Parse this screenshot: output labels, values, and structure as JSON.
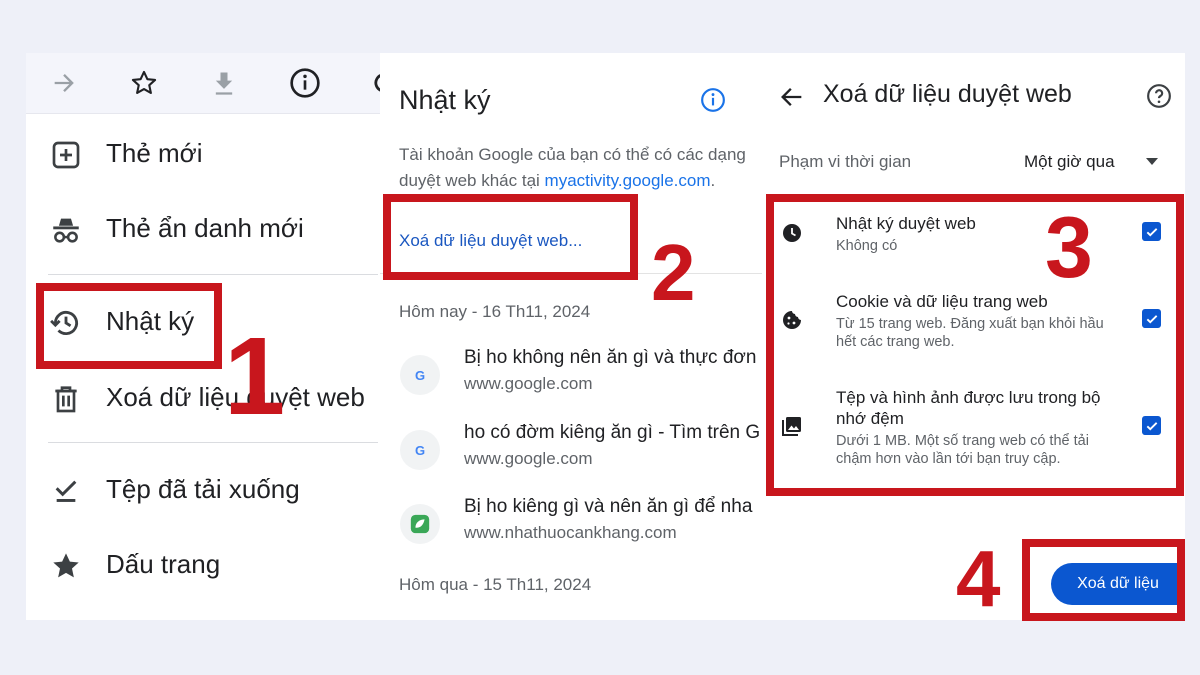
{
  "menu": {
    "toolbar_icons": [
      "arrow-forward-icon",
      "star-icon",
      "download-icon",
      "info-icon",
      "refresh-icon"
    ],
    "items": [
      {
        "label": "Thẻ mới",
        "icon": "new-tab-icon"
      },
      {
        "label": "Thẻ ẩn danh mới",
        "icon": "incognito-icon"
      },
      {
        "label": "Nhật ký",
        "icon": "history-icon"
      },
      {
        "label": "Xoá dữ liệu duyệt web",
        "icon": "trash-icon"
      },
      {
        "label": "Tệp đã tải xuống",
        "icon": "download-done-icon"
      },
      {
        "label": "Dấu trang",
        "icon": "bookmark-star-icon"
      }
    ]
  },
  "history": {
    "title": "Nhật ký",
    "description_line1": "Tài khoản Google của bạn có thể có các dạng",
    "description_prefix": "duyệt web khác tại ",
    "description_link": "myactivity.google.com",
    "description_suffix": ".",
    "clear_link": "Xoá dữ liệu duyệt web...",
    "groups": [
      {
        "date": "Hôm nay - 16 Th11, 2024",
        "entries": [
          {
            "title": "Bị ho không nên ăn gì và thực đơn",
            "url": "www.google.com",
            "favicon": "G"
          },
          {
            "title": "ho có đờm kiêng ăn gì - Tìm trên G",
            "url": "www.google.com",
            "favicon": "G"
          },
          {
            "title": "Bị ho kiêng gì và nên ăn gì để nha",
            "url": "www.nhathuocankhang.com",
            "favicon": "leaf"
          }
        ]
      },
      {
        "date": "Hôm qua - 15 Th11, 2024",
        "entries": []
      }
    ]
  },
  "clear_data": {
    "title": "Xoá dữ liệu duyệt web",
    "time_range_label": "Phạm vi thời gian",
    "time_range_value": "Một giờ qua",
    "items": [
      {
        "title": "Nhật ký duyệt web",
        "subtitle": "Không có",
        "checked": true,
        "icon": "clock-icon"
      },
      {
        "title": "Cookie và dữ liệu trang web",
        "subtitle": "Từ 15 trang web. Đăng xuất bạn khỏi hầu hết các trang web.",
        "checked": true,
        "icon": "cookie-icon"
      },
      {
        "title": "Tệp và hình ảnh được lưu trong bộ nhớ đệm",
        "subtitle": "Dưới 1 MB. Một số trang web có thể tải chậm hơn vào lần tới bạn truy cập.",
        "checked": true,
        "icon": "image-icon"
      }
    ],
    "confirm_button": "Xoá dữ liệu"
  },
  "steps": [
    "1",
    "2",
    "3",
    "4"
  ],
  "colors": {
    "accent": "#0b57d0",
    "annotation": "#c8161d",
    "link": "#1a73e8"
  }
}
